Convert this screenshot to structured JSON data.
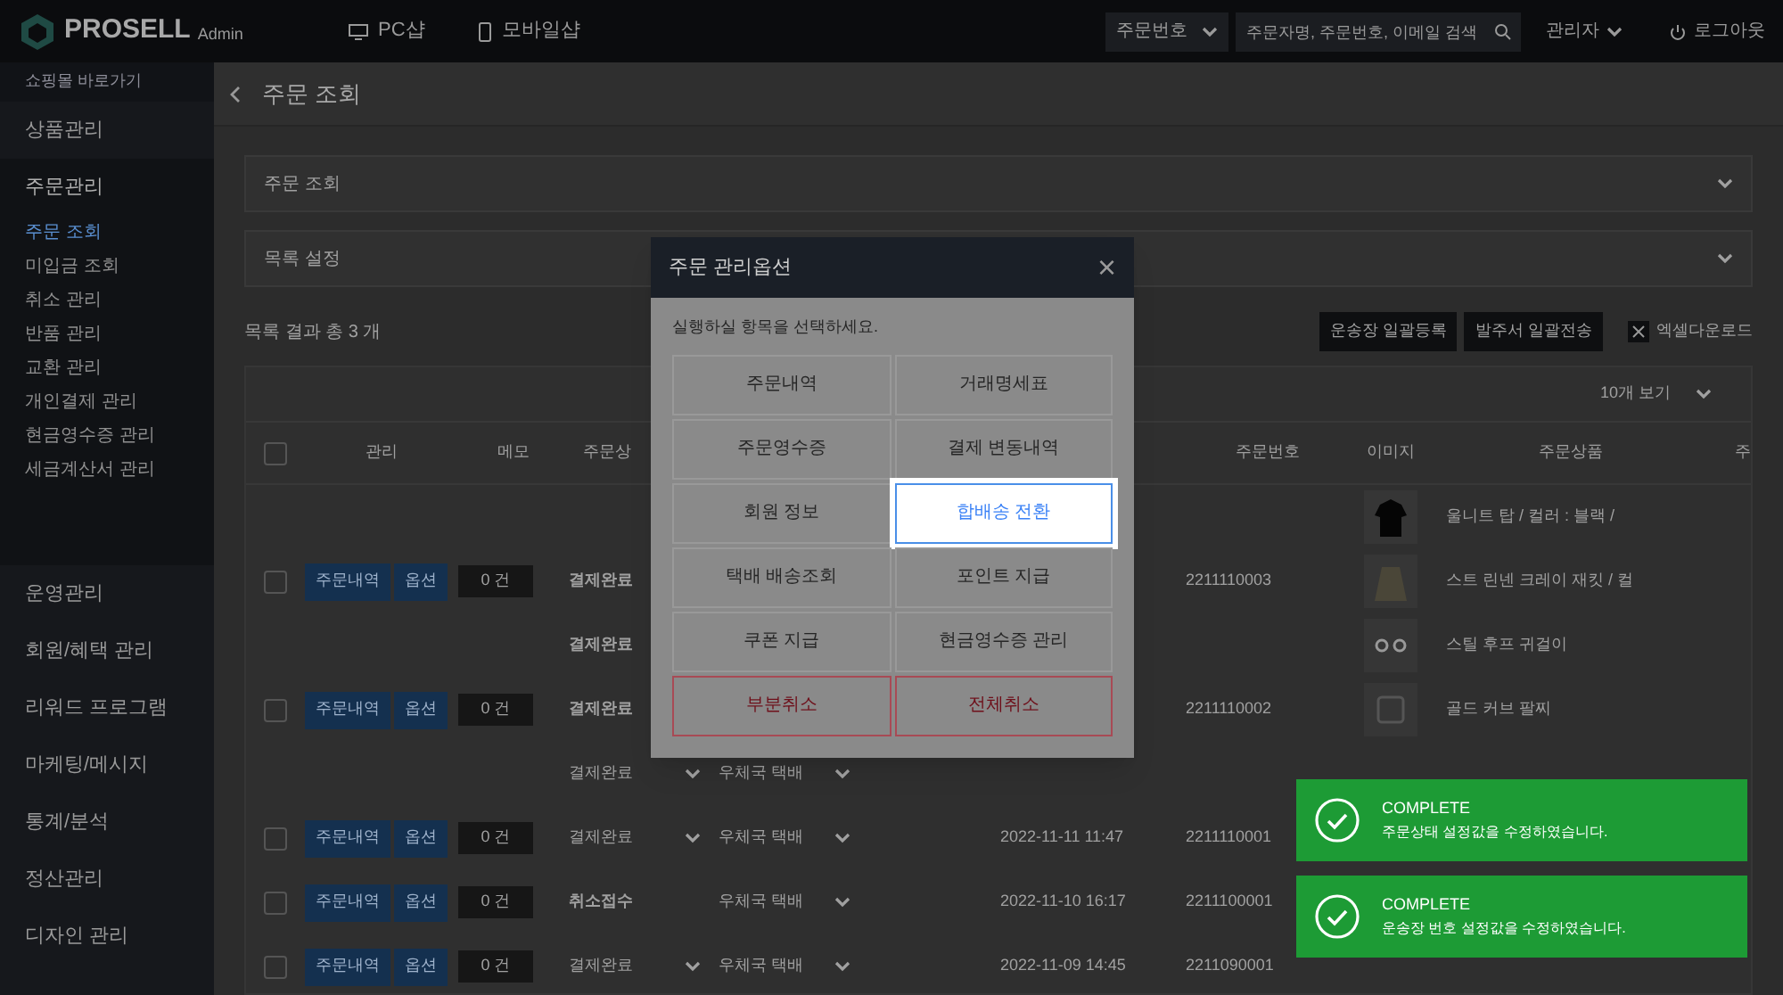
{
  "topbar": {
    "logo": "PROSELL",
    "logo_sub": "Admin",
    "links": [
      {
        "label": "PC샵",
        "kind": "monitor"
      },
      {
        "label": "모바일샵",
        "kind": "phone"
      }
    ],
    "search_type": "주문번호",
    "search": {
      "placeholder": "주문자명, 주문번호, 이메일 검색"
    },
    "user": "관리자",
    "logout": "로그아웃"
  },
  "sidebar": {
    "top": "쇼핑몰 바로가기",
    "items": [
      {
        "label": "상품관리",
        "expanded": false
      },
      {
        "label": "주문관리",
        "expanded": true,
        "children": [
          {
            "label": "주문 조회",
            "selected": true
          },
          {
            "label": "미입금 조회",
            "selected": false
          },
          {
            "label": "취소 관리",
            "selected": false
          },
          {
            "label": "반품 관리",
            "selected": false
          },
          {
            "label": "교환 관리",
            "selected": false
          },
          {
            "label": "개인결제 관리",
            "selected": false
          },
          {
            "label": "현금영수증 관리",
            "selected": false
          },
          {
            "label": "세금계산서 관리",
            "selected": false
          }
        ]
      },
      {
        "label": "운영관리",
        "expanded": false
      },
      {
        "label": "회원/혜택 관리",
        "expanded": false
      },
      {
        "label": "리워드 프로그램",
        "expanded": false
      },
      {
        "label": "마케팅/메시지",
        "expanded": false
      },
      {
        "label": "통계/분석",
        "expanded": false
      },
      {
        "label": "정산관리",
        "expanded": false
      },
      {
        "label": "디자인 관리",
        "expanded": false
      }
    ]
  },
  "page": {
    "title": "주문 조회",
    "panels": [
      "주문 조회",
      "목록 설정"
    ],
    "result": "목록 결과 총 3 개",
    "actions": [
      "운송장 일괄등록",
      "발주서 일괄전송"
    ],
    "excel": "엑셀다운로드",
    "page_size": "10개 보기"
  },
  "table": {
    "select_all_checked": false,
    "columns": [
      "관리",
      "메모",
      "주문상",
      "",
      "",
      "",
      "주문번호",
      "이미지",
      "주문상품",
      "주"
    ],
    "lines": [
      {
        "product": "울니트 탑 / 컬러 : 블랙 /"
      },
      {
        "checked": false,
        "buttons": [
          "주문내역",
          "옵션"
        ],
        "memo": "0 건",
        "status": "결제완료",
        "status_select": false,
        "order_no": "2211110003",
        "product": "스트 린넨 크레이 재킷 / 컬"
      },
      {
        "status": "결제완료",
        "status_select": false,
        "product": "스틸 후프 귀걸이"
      },
      {
        "checked": false,
        "buttons": [
          "주문내역",
          "옵션"
        ],
        "memo": "0 건",
        "status": "결제완료",
        "status_select": false,
        "order_no": "2211110002",
        "product": "골드 커브 팔찌"
      },
      {
        "status": "결제완료",
        "status_select": true,
        "carrier": "우체국 택배"
      },
      {
        "checked": false,
        "buttons": [
          "주문내역",
          "옵션"
        ],
        "memo": "0 건",
        "status": "결제완료",
        "status_select": true,
        "carrier": "우체국 택배",
        "date": "2022-11-11 11:47",
        "order_no": "2211110001"
      },
      {
        "checked": false,
        "buttons": [
          "주문내역",
          "옵션"
        ],
        "memo": "0 건",
        "status": "취소접수",
        "status_select": false,
        "carrier": "우체국 택배",
        "date": "2022-11-10 16:17",
        "order_no": "2211100001"
      },
      {
        "checked": false,
        "buttons": [
          "주문내역",
          "옵션"
        ],
        "memo": "0 건",
        "status": "결제완료",
        "status_select": true,
        "carrier": "우체국 택배",
        "date": "2022-11-09 14:45",
        "order_no": "2211090001"
      }
    ]
  },
  "modal": {
    "title": "주문 관리옵션",
    "close": "×",
    "prompt": "실행하실 항목을 선택하세요.",
    "options": [
      {
        "label": "주문내역",
        "kind": "normal",
        "selected": false
      },
      {
        "label": "거래명세표",
        "kind": "normal",
        "selected": false
      },
      {
        "label": "주문영수증",
        "kind": "normal",
        "selected": false
      },
      {
        "label": "결제 변동내역",
        "kind": "normal",
        "selected": false
      },
      {
        "label": "회원 정보",
        "kind": "normal",
        "selected": false
      },
      {
        "label": "합배송 전환",
        "kind": "normal",
        "selected": true
      },
      {
        "label": "택배 배송조회",
        "kind": "normal",
        "selected": false
      },
      {
        "label": "포인트 지급",
        "kind": "normal",
        "selected": false
      },
      {
        "label": "쿠폰 지급",
        "kind": "normal",
        "selected": false
      },
      {
        "label": "현금영수증 관리",
        "kind": "normal",
        "selected": false
      },
      {
        "label": "부분취소",
        "kind": "danger",
        "selected": false
      },
      {
        "label": "전체취소",
        "kind": "danger",
        "selected": false
      }
    ]
  },
  "toasts": [
    {
      "title": "COMPLETE",
      "message": "주문상태 설정값을 수정하였습니다."
    },
    {
      "title": "COMPLETE",
      "message": "운송장 번호 설정값을 수정하였습니다."
    }
  ]
}
